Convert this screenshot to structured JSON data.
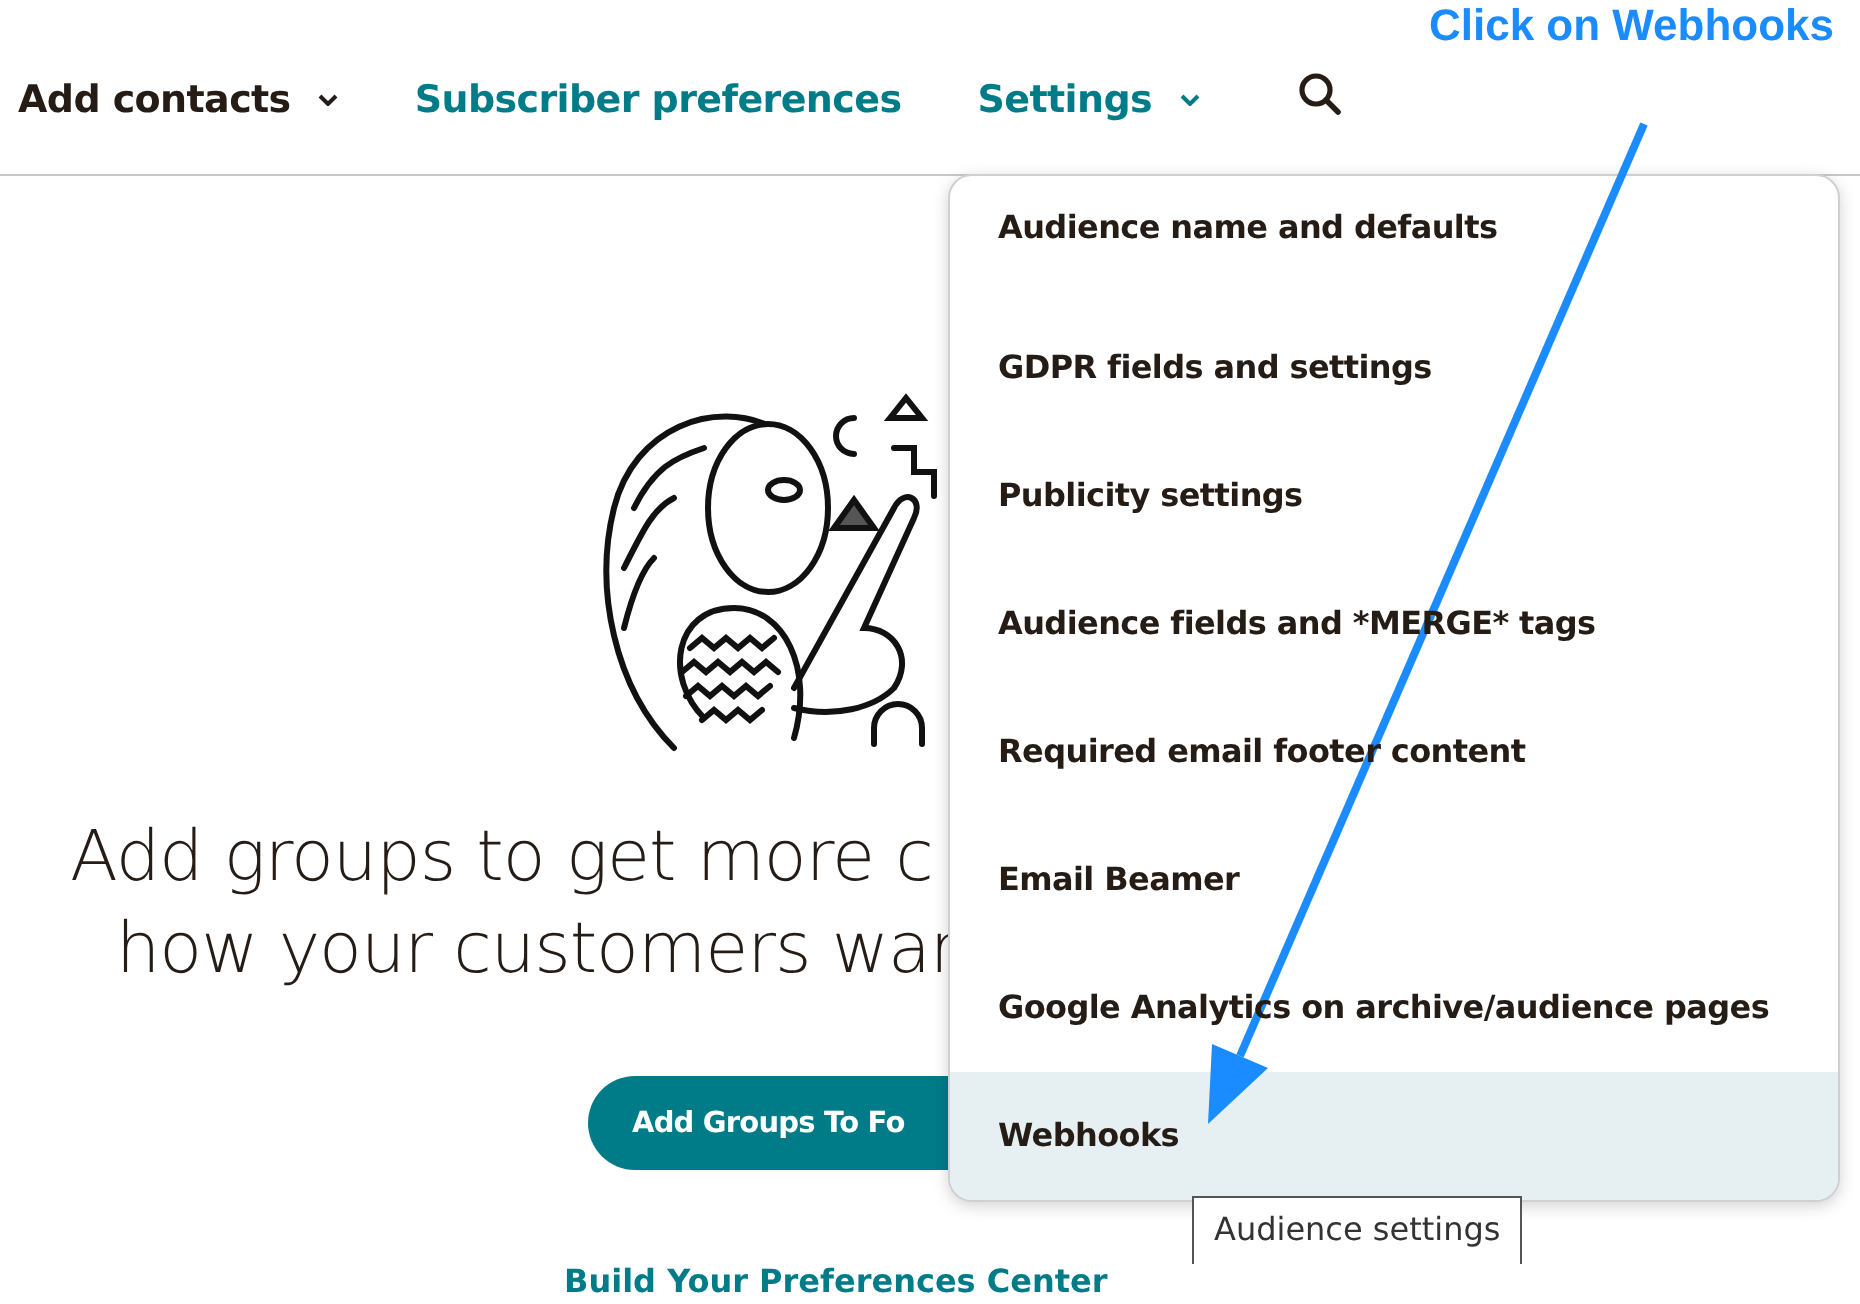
{
  "annotation": {
    "text": "Click on Webhooks"
  },
  "nav": [
    {
      "label": "Add contacts",
      "kind": "dropdown"
    },
    {
      "label": "Subscriber preferences",
      "kind": "link"
    },
    {
      "label": "Settings",
      "kind": "dropdown"
    },
    {
      "kind": "search"
    }
  ],
  "empty_state": {
    "heading_lines": [
      "Add groups to get more c",
      "how your customers war"
    ],
    "button": "Add Groups To Fo",
    "link": "Build Your Preferences Center"
  },
  "settings_menu": [
    {
      "label": "Audience name and defaults",
      "selected": false
    },
    {
      "label": "GDPR fields and settings",
      "selected": false
    },
    {
      "label": "Publicity settings",
      "selected": false
    },
    {
      "label": "Audience fields and *MERGE* tags",
      "selected": false
    },
    {
      "label": "Required email footer content",
      "selected": false
    },
    {
      "label": "Email Beamer",
      "selected": false
    },
    {
      "label": "Google Analytics on archive/audience pages",
      "selected": false
    },
    {
      "label": "Webhooks",
      "selected": true
    }
  ],
  "tooltip": "Audience settings"
}
